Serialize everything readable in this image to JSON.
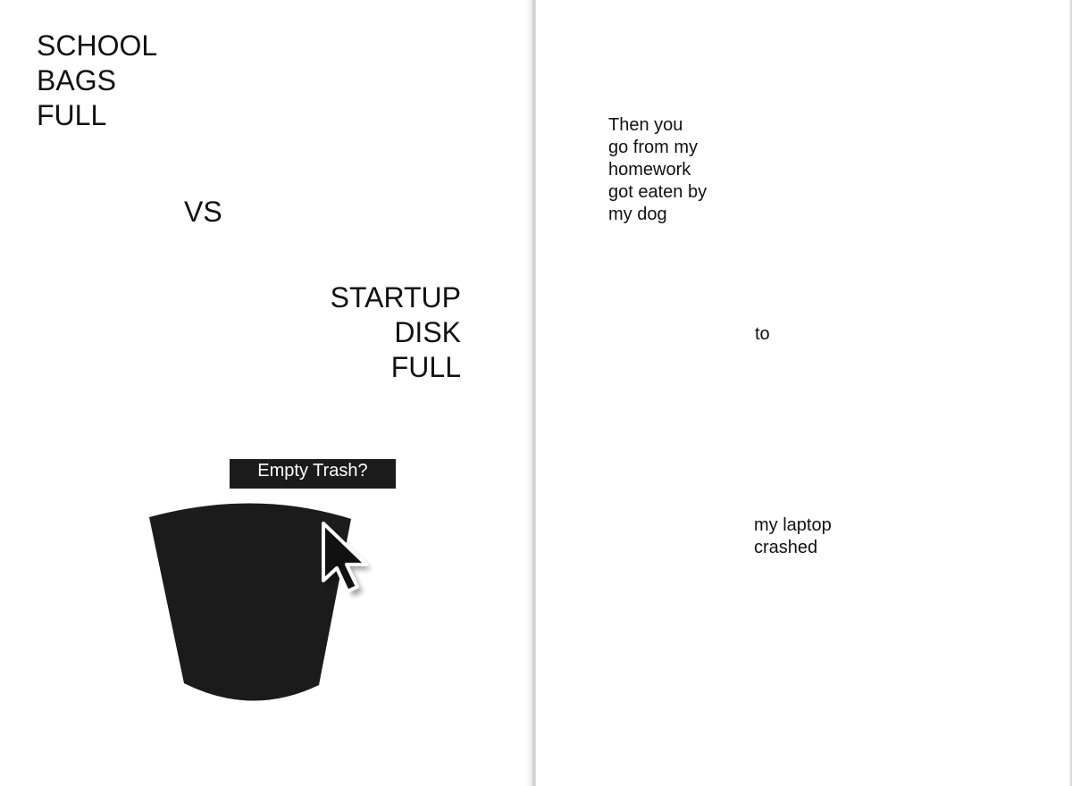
{
  "left_page": {
    "school_lines": [
      "SCHOOL",
      "BAGS",
      "FULL"
    ],
    "vs": "VS",
    "startup_lines": [
      "STARTUP",
      "DISK",
      "FULL"
    ],
    "trash_prompt": "Empty Trash?",
    "trash_icon": "trash-can-icon",
    "cursor_icon": "arrow-cursor-icon"
  },
  "right_page": {
    "then_lines": [
      "Then you",
      "go from my",
      "homework",
      "got eaten by",
      "my dog"
    ],
    "to": "to",
    "laptop_lines": [
      "my laptop",
      "crashed"
    ]
  },
  "colors": {
    "ink": "#111111",
    "trash_fill": "#1b1b1b",
    "label_text": "#ffffff",
    "paper": "#ffffff"
  }
}
